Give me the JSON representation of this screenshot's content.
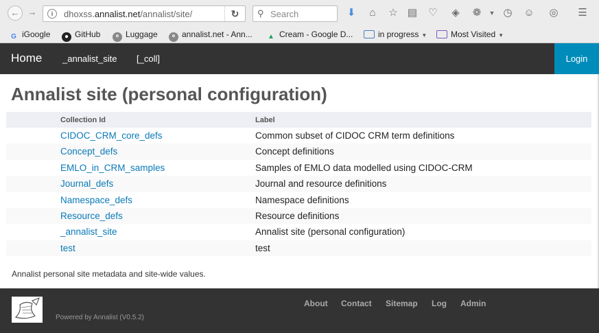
{
  "browser": {
    "url_prefix": "dhoxss.",
    "url_domain": "annalist.net",
    "url_path": "/annalist/site/",
    "search_placeholder": "Search",
    "bookmarks": [
      {
        "label": "iGoogle",
        "icon": "google-icon"
      },
      {
        "label": "GitHub",
        "icon": "github-icon"
      },
      {
        "label": "Luggage",
        "icon": "globe-icon"
      },
      {
        "label": "annalist.net - Ann...",
        "icon": "globe-icon"
      },
      {
        "label": "Cream - Google D...",
        "icon": "google-drive-icon"
      },
      {
        "label": "in progress",
        "icon": "folder-icon"
      },
      {
        "label": "Most Visited",
        "icon": "folder-icon"
      }
    ]
  },
  "navbar": {
    "brand": "Home",
    "links": [
      "_annalist_site",
      "[_coll]"
    ],
    "login": "Login"
  },
  "page": {
    "title": "Annalist site (personal configuration)",
    "description": "Annalist personal site metadata and site-wide values."
  },
  "table": {
    "headers": {
      "id": "Collection Id",
      "label": "Label"
    },
    "rows": [
      {
        "id": "CIDOC_CRM_core_defs",
        "label": "Common subset of CIDOC CRM term definitions"
      },
      {
        "id": "Concept_defs",
        "label": "Concept definitions"
      },
      {
        "id": "EMLO_in_CRM_samples",
        "label": "Samples of EMLO data modelled using CIDOC-CRM"
      },
      {
        "id": "Journal_defs",
        "label": "Journal and resource definitions"
      },
      {
        "id": "Namespace_defs",
        "label": "Namespace definitions"
      },
      {
        "id": "Resource_defs",
        "label": "Resource definitions"
      },
      {
        "id": "_annalist_site",
        "label": "Annalist site (personal configuration)"
      },
      {
        "id": "test",
        "label": "test"
      }
    ]
  },
  "footer": {
    "powered": "Powered by Annalist (V0.5.2)",
    "links": [
      "About",
      "Contact",
      "Sitemap",
      "Log",
      "Admin"
    ]
  },
  "colors": {
    "navbar_bg": "#333333",
    "login_bg": "#008cba",
    "link": "#0a7ab8"
  }
}
